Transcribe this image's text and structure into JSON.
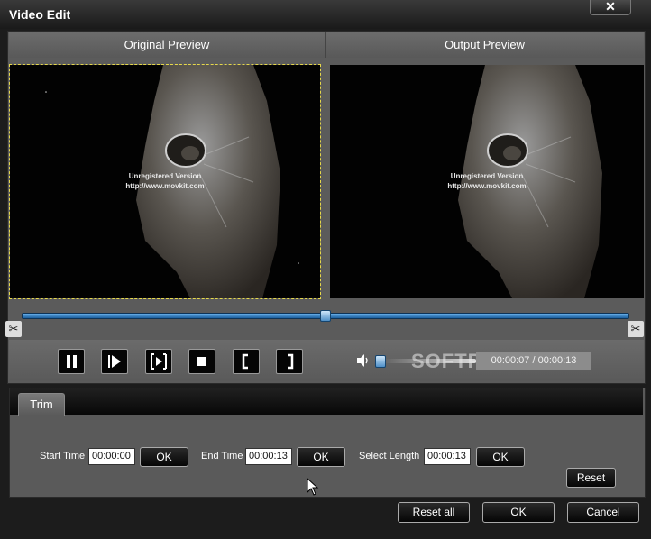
{
  "window": {
    "title": "Video Edit",
    "close_glyph": "✕"
  },
  "preview": {
    "original_label": "Original Preview",
    "output_label": "Output Preview",
    "watermark_line1": "Unregistered Version",
    "watermark_line2": "http://www.movkit.com"
  },
  "seek": {
    "position_fraction": 0.5
  },
  "controls": {
    "buttons": [
      "pause-icon",
      "play-next-frame-icon",
      "frame-step-icon",
      "stop-icon",
      "mark-in-icon",
      "mark-out-icon"
    ],
    "volume_fraction": 0.0,
    "time": "00:00:07 / 00:00:13"
  },
  "watermark": "SOFTPEDIA",
  "trim": {
    "tab_label": "Trim",
    "start_label": "Start Time",
    "start_value": "00:00:00",
    "end_label": "End Time",
    "end_value": "00:00:13",
    "length_label": "Select Length",
    "length_value": "00:00:13",
    "ok_label": "OK",
    "reset_label": "Reset"
  },
  "footer": {
    "reset_all": "Reset all",
    "ok": "OK",
    "cancel": "Cancel"
  },
  "colors": {
    "accent": "#3a8ad6",
    "background": "#1c1c1c",
    "panel": "#5b5b5b"
  }
}
